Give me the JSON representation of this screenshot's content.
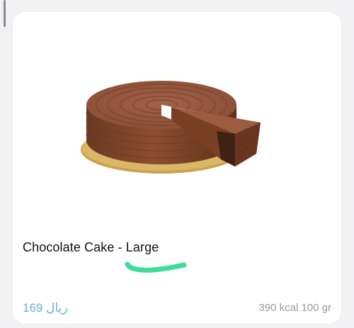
{
  "product": {
    "name": "Chocolate Cake - Large",
    "price": "169 ريال",
    "nutrition": "390 kcal 100 gr",
    "image_subject": "chocolate-cake-with-slice-cut"
  },
  "colors": {
    "price": "#67b0d9",
    "highlight_mark": "#3ddc97",
    "card_background": "#ffffff",
    "page_background": "#f2f2f4"
  }
}
